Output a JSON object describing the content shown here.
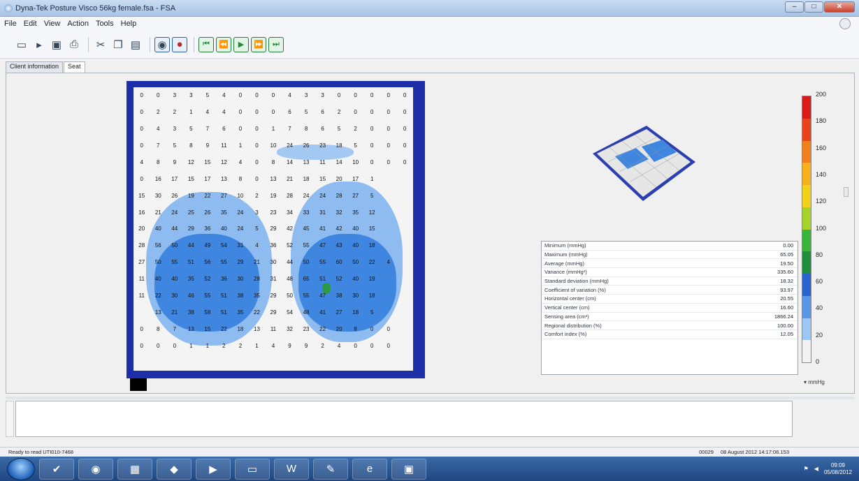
{
  "window": {
    "title": "Dyna-Tek Posture Visco 56kg female.fsa - FSA"
  },
  "menu": [
    "File",
    "Edit",
    "View",
    "Action",
    "Tools",
    "Help"
  ],
  "tabs": [
    "Client information",
    "Seat"
  ],
  "grid_values": [
    [
      "0",
      "0",
      "3",
      "3",
      "5",
      "4",
      "0",
      "0",
      "0",
      "4",
      "3",
      "3",
      "0",
      "0",
      "0",
      "0",
      "0"
    ],
    [
      "0",
      "2",
      "2",
      "1",
      "4",
      "4",
      "0",
      "0",
      "0",
      "6",
      "5",
      "6",
      "2",
      "0",
      "0",
      "0",
      "0"
    ],
    [
      "0",
      "4",
      "3",
      "5",
      "7",
      "6",
      "0",
      "0",
      "1",
      "7",
      "8",
      "6",
      "5",
      "2",
      "0",
      "0",
      "0"
    ],
    [
      "0",
      "7",
      "5",
      "8",
      "9",
      "11",
      "1",
      "0",
      "10",
      "24",
      "26",
      "23",
      "18",
      "5",
      "0",
      "0",
      "0"
    ],
    [
      "4",
      "8",
      "9",
      "12",
      "15",
      "12",
      "4",
      "0",
      "8",
      "14",
      "13",
      "11",
      "14",
      "10",
      "0",
      "0",
      "0"
    ],
    [
      "0",
      "16",
      "17",
      "15",
      "17",
      "13",
      "8",
      "0",
      "13",
      "21",
      "18",
      "15",
      "20",
      "17",
      "1",
      "",
      ""
    ],
    [
      "15",
      "30",
      "26",
      "19",
      "22",
      "27",
      "10",
      "2",
      "19",
      "28",
      "24",
      "24",
      "28",
      "27",
      "5",
      "",
      ""
    ],
    [
      "16",
      "21",
      "24",
      "25",
      "26",
      "35",
      "24",
      "3",
      "23",
      "34",
      "33",
      "31",
      "32",
      "35",
      "12",
      "",
      ""
    ],
    [
      "20",
      "40",
      "44",
      "29",
      "36",
      "40",
      "24",
      "5",
      "29",
      "42",
      "45",
      "41",
      "42",
      "40",
      "15",
      "",
      ""
    ],
    [
      "28",
      "56",
      "50",
      "44",
      "49",
      "54",
      "31",
      "4",
      "36",
      "52",
      "55",
      "47",
      "43",
      "40",
      "18",
      "",
      ""
    ],
    [
      "27",
      "50",
      "55",
      "51",
      "56",
      "55",
      "29",
      "21",
      "30",
      "44",
      "50",
      "55",
      "60",
      "50",
      "22",
      "4",
      ""
    ],
    [
      "11",
      "40",
      "40",
      "35",
      "52",
      "36",
      "30",
      "28",
      "31",
      "48",
      "65",
      "51",
      "52",
      "40",
      "19",
      "",
      ""
    ],
    [
      "11",
      "22",
      "30",
      "46",
      "55",
      "51",
      "38",
      "35",
      "29",
      "50",
      "55",
      "47",
      "38",
      "30",
      "18",
      "",
      ""
    ],
    [
      "",
      "13",
      "21",
      "38",
      "58",
      "51",
      "35",
      "22",
      "29",
      "54",
      "48",
      "41",
      "27",
      "18",
      "5",
      "",
      ""
    ],
    [
      "0",
      "8",
      "7",
      "13",
      "15",
      "22",
      "18",
      "13",
      "11",
      "32",
      "23",
      "22",
      "20",
      "8",
      "0",
      "0",
      ""
    ],
    [
      "0",
      "0",
      "0",
      "1",
      "1",
      "2",
      "2",
      "1",
      "4",
      "9",
      "9",
      "2",
      "4",
      "0",
      "0",
      "0",
      ""
    ]
  ],
  "stats": [
    {
      "label": "Minimum (mmHg)",
      "value": "0.00"
    },
    {
      "label": "Maximum (mmHg)",
      "value": "65.05"
    },
    {
      "label": "Average (mmHg)",
      "value": "19.50"
    },
    {
      "label": "Variance (mmHg²)",
      "value": "335.60"
    },
    {
      "label": "Standard deviation (mmHg)",
      "value": "18.32"
    },
    {
      "label": "Coefficient of variation (%)",
      "value": "93.97"
    },
    {
      "label": "Horizontal center (cm)",
      "value": "20.55"
    },
    {
      "label": "Vertical center (cm)",
      "value": "16.60"
    },
    {
      "label": "Sensing area (cm²)",
      "value": "1866.24"
    },
    {
      "label": "Regional distribution (%)",
      "value": "100.00"
    },
    {
      "label": "Comfort index (%)",
      "value": "12.05"
    }
  ],
  "scale": {
    "labels": [
      "200",
      "180",
      "160",
      "140",
      "120",
      "100",
      "80",
      "60",
      "40",
      "20",
      "0"
    ],
    "unit": "mmHg",
    "colors": [
      "#d81b1b",
      "#e8431d",
      "#f27f1d",
      "#f6b21c",
      "#f0d21a",
      "#a7d22a",
      "#3bb43b",
      "#1f8f3c",
      "#2b62cf",
      "#5a97e6",
      "#9bc7f2",
      "#f2f2f2"
    ]
  },
  "status": {
    "left": "Ready to read UTI010-7468",
    "code": "00029",
    "timestamp": "08 August 2012 14:17:06.153"
  },
  "tray": {
    "time": "09:09",
    "date": "05/08/2012"
  }
}
